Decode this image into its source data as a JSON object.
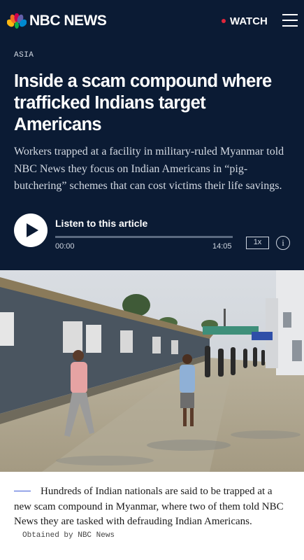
{
  "header": {
    "logo_text": "NBC NEWS",
    "watch_label": "WATCH",
    "live_dot_color": "#e0263b",
    "menu_icon": "hamburger-icon",
    "background": "#0b1b34"
  },
  "article": {
    "kicker": "ASIA",
    "headline": "Inside a scam compound where trafficked Indians target Americans",
    "dek": "Workers trapped at a facility in military-ruled Myanmar told NBC News they focus on Indian Americans in “pig-butchering” schemes that can cost victims their life savings."
  },
  "audio_player": {
    "title": "Listen to this article",
    "current_time": "00:00",
    "duration": "14:05",
    "speed": "1x",
    "progress": 0,
    "info_icon": "info-icon",
    "play_icon": "play-icon"
  },
  "photo": {
    "caption": "Hundreds of Indian nationals are said to be trapped at a new scam compound in Myanmar, where two of them told NBC News they are tasked with defrauding Indian Americans.",
    "credit": "Obtained by NBC News",
    "caption_rule_color": "#3d5bd6"
  }
}
